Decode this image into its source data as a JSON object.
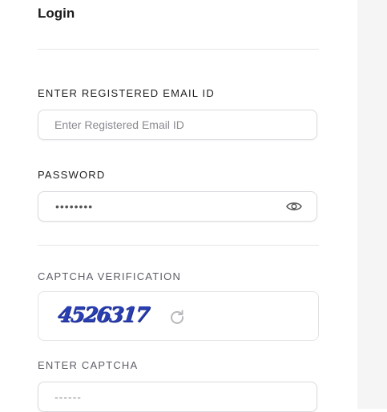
{
  "form": {
    "title": "Login",
    "email": {
      "label": "ENTER REGISTERED EMAIL ID",
      "placeholder": "Enter Registered Email ID"
    },
    "password": {
      "label": "PASSWORD",
      "masked_value": "••••••••",
      "toggle_icon": "eye-icon"
    },
    "captcha": {
      "section_label": "CAPTCHA VERIFICATION",
      "code": "4526317",
      "refresh_icon": "refresh-icon",
      "input_label": "ENTER CAPTCHA",
      "input_placeholder": "------"
    }
  },
  "colors": {
    "background": "#ffffff",
    "side_panel": "#f5f5f6",
    "border": "#dcdce0",
    "captcha_text": "#2a3fb3"
  }
}
